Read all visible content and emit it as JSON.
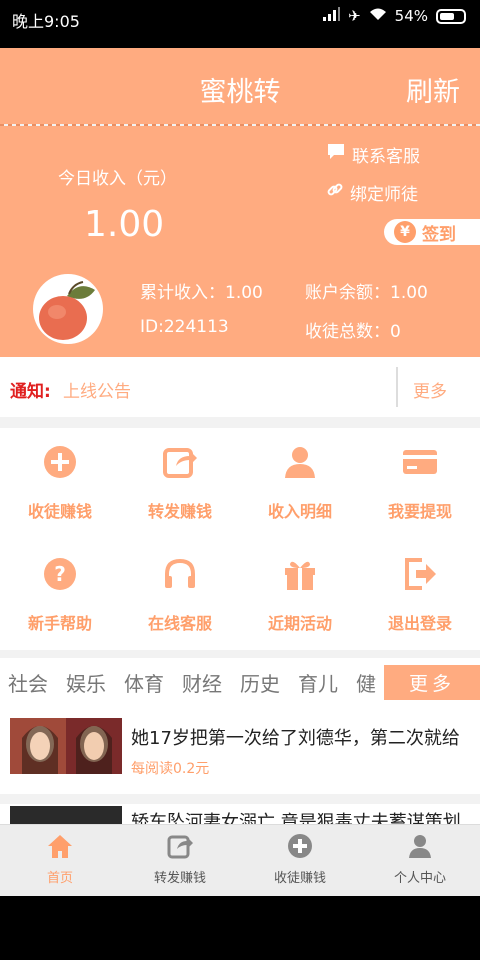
{
  "status_bar": {
    "time": "晚上9:05",
    "battery": "54%"
  },
  "header": {
    "title": "蜜桃转",
    "refresh": "刷新"
  },
  "hero": {
    "today_label": "今日收入（元）",
    "today_value": "1.00",
    "contact": "联系客服",
    "bind": "绑定师徒",
    "signin": "签到",
    "yen_symbol": "¥",
    "total_income": "累计收入：1.00",
    "balance": "账户余额：1.00",
    "id": "ID:224113",
    "apprentices": "收徒总数：0"
  },
  "notice": {
    "label": "通知:",
    "text": "上线公告",
    "more": "更多"
  },
  "grid": [
    {
      "label": "收徒赚钱",
      "icon": "plus-circle-icon"
    },
    {
      "label": "转发赚钱",
      "icon": "share-icon"
    },
    {
      "label": "收入明细",
      "icon": "user-icon"
    },
    {
      "label": "我要提现",
      "icon": "card-icon"
    },
    {
      "label": "新手帮助",
      "icon": "question-icon"
    },
    {
      "label": "在线客服",
      "icon": "headphones-icon"
    },
    {
      "label": "近期活动",
      "icon": "gift-icon"
    },
    {
      "label": "退出登录",
      "icon": "logout-icon"
    }
  ],
  "tabs": [
    "社会",
    "娱乐",
    "体育",
    "财经",
    "历史",
    "育儿",
    "健"
  ],
  "tabs_more": "更多",
  "articles": [
    {
      "title": "她17岁把第一次给了刘德华，第二次就给",
      "reward": "每阅读0.2元"
    },
    {
      "title": "轿车坠河妻女溺亡 竟是狠毒丈夫蓄谋策划"
    }
  ],
  "bottom_nav": [
    {
      "label": "首页",
      "icon": "home-icon",
      "active": true
    },
    {
      "label": "转发赚钱",
      "icon": "share-icon"
    },
    {
      "label": "收徒赚钱",
      "icon": "plus-circle-icon"
    },
    {
      "label": "个人中心",
      "icon": "user-icon"
    }
  ],
  "colors": {
    "accent": "#ffab80",
    "accent_text": "#ff9f6b",
    "notice_red": "#e02020"
  }
}
